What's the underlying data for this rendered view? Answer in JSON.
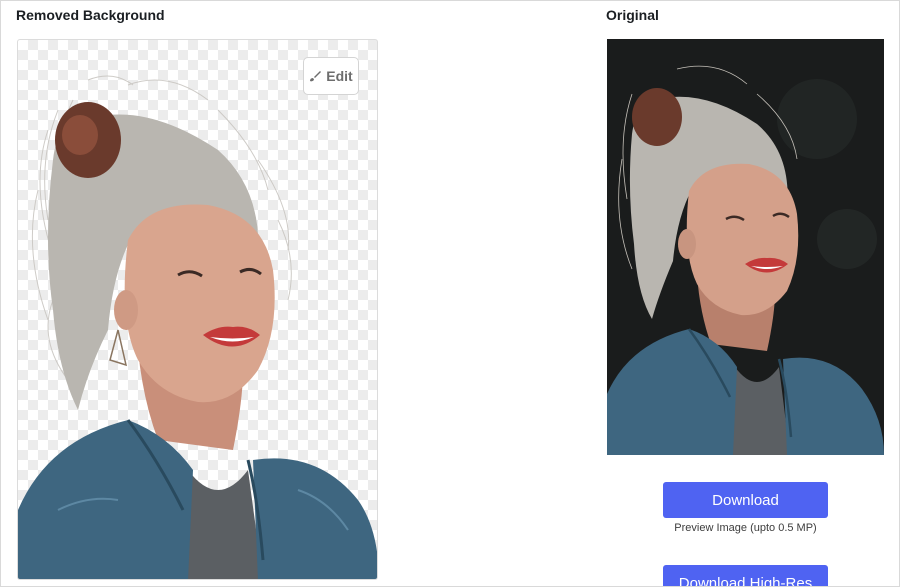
{
  "headings": {
    "removed": "Removed Background",
    "original": "Original"
  },
  "edit_button": {
    "label": "Edit",
    "icon": "paintbrush-icon"
  },
  "download": {
    "label": "Download",
    "caption": "Preview Image (upto 0.5 MP)"
  },
  "download_highres": {
    "label": "Download High-Res"
  },
  "colors": {
    "accent": "#4f63f2",
    "checker": "#ececec",
    "photo_bg": "#1a1c1c",
    "denim": "#3e6680",
    "skin": "#d9a58e",
    "hair": "#b9b6b0",
    "bun": "#6a3a2c",
    "lips": "#c43a3a"
  }
}
